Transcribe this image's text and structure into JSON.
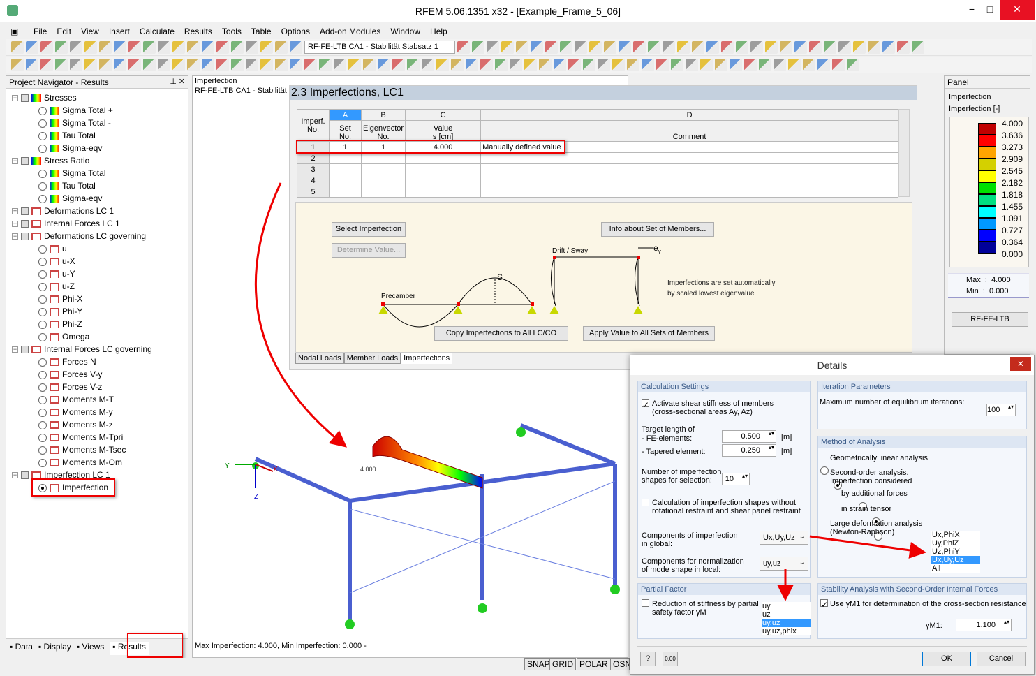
{
  "window": {
    "title": "RFEM 5.06.1351 x32 - [Example_Frame_5_06]",
    "minimize": "−",
    "maximize": "□",
    "close": "✕"
  },
  "menu": [
    "File",
    "Edit",
    "View",
    "Insert",
    "Calculate",
    "Results",
    "Tools",
    "Table",
    "Options",
    "Add-on Modules",
    "Window",
    "Help"
  ],
  "toolbar": {
    "case_combo": "RF-FE-LTB CA1 - Stabilität Stabsatz 1"
  },
  "navigator": {
    "title": "Project Navigator - Results",
    "items": [
      {
        "label": "Stresses",
        "level": 0,
        "kind": "check",
        "icon": "stress-icon",
        "exp": "−"
      },
      {
        "label": "Sigma Total +",
        "level": 1,
        "kind": "radio",
        "icon": "stress-icon"
      },
      {
        "label": "Sigma Total -",
        "level": 1,
        "kind": "radio",
        "icon": "stress-icon"
      },
      {
        "label": "Tau Total",
        "level": 1,
        "kind": "radio",
        "icon": "stress-icon"
      },
      {
        "label": "Sigma-eqv",
        "level": 1,
        "kind": "radio",
        "icon": "stress-icon"
      },
      {
        "label": "Stress Ratio",
        "level": 0,
        "kind": "check",
        "icon": "stress-icon",
        "exp": "−"
      },
      {
        "label": "Sigma Total",
        "level": 1,
        "kind": "radio",
        "icon": "stress-icon"
      },
      {
        "label": "Tau Total",
        "level": 1,
        "kind": "radio",
        "icon": "stress-icon"
      },
      {
        "label": "Sigma-eqv",
        "level": 1,
        "kind": "radio",
        "icon": "stress-icon"
      },
      {
        "label": "Deformations LC 1",
        "level": 0,
        "kind": "check",
        "icon": "frame-icon",
        "exp": "+"
      },
      {
        "label": "Internal Forces LC 1",
        "level": 0,
        "kind": "check",
        "icon": "force-icon",
        "exp": "+"
      },
      {
        "label": "Deformations LC governing",
        "level": 0,
        "kind": "check",
        "icon": "frame-icon",
        "exp": "−"
      },
      {
        "label": "u",
        "level": 1,
        "kind": "radio",
        "icon": "frame-icon"
      },
      {
        "label": "u-X",
        "level": 1,
        "kind": "radio",
        "icon": "frame-icon"
      },
      {
        "label": "u-Y",
        "level": 1,
        "kind": "radio",
        "icon": "frame-icon"
      },
      {
        "label": "u-Z",
        "level": 1,
        "kind": "radio",
        "icon": "frame-icon"
      },
      {
        "label": "Phi-X",
        "level": 1,
        "kind": "radio",
        "icon": "frame-icon"
      },
      {
        "label": "Phi-Y",
        "level": 1,
        "kind": "radio",
        "icon": "frame-icon"
      },
      {
        "label": "Phi-Z",
        "level": 1,
        "kind": "radio",
        "icon": "frame-icon"
      },
      {
        "label": "Omega",
        "level": 1,
        "kind": "radio",
        "icon": "frame-icon"
      },
      {
        "label": "Internal Forces LC governing",
        "level": 0,
        "kind": "check",
        "icon": "force-icon",
        "exp": "−"
      },
      {
        "label": "Forces N",
        "level": 1,
        "kind": "radio",
        "icon": "force-icon"
      },
      {
        "label": "Forces V-y",
        "level": 1,
        "kind": "radio",
        "icon": "force-icon"
      },
      {
        "label": "Forces V-z",
        "level": 1,
        "kind": "radio",
        "icon": "force-icon"
      },
      {
        "label": "Moments M-T",
        "level": 1,
        "kind": "radio",
        "icon": "force-icon"
      },
      {
        "label": "Moments M-y",
        "level": 1,
        "kind": "radio",
        "icon": "force-icon"
      },
      {
        "label": "Moments M-z",
        "level": 1,
        "kind": "radio",
        "icon": "force-icon"
      },
      {
        "label": "Moments M-Tpri",
        "level": 1,
        "kind": "radio",
        "icon": "force-icon"
      },
      {
        "label": "Moments M-Tsec",
        "level": 1,
        "kind": "radio",
        "icon": "force-icon"
      },
      {
        "label": "Moments M-Om",
        "level": 1,
        "kind": "radio",
        "icon": "force-icon"
      },
      {
        "label": "Imperfection LC 1",
        "level": 0,
        "kind": "check",
        "icon": "frame-icon",
        "exp": "−"
      },
      {
        "label": "Imperfection",
        "level": 1,
        "kind": "radio",
        "icon": "frame-icon",
        "selected": true
      }
    ],
    "tabs": [
      "Data",
      "Display",
      "Views",
      "Results"
    ]
  },
  "view": {
    "header1": "Imperfection",
    "header2": "RF-FE-LTB CA1 - Stabilität",
    "footer": "Max Imperfection: 4.000, Min Imperfection: 0.000 -",
    "axis_y": "Y",
    "axis_x": "X",
    "axis_z": "Z",
    "value_label": "4.000"
  },
  "table": {
    "title": "2.3 Imperfections, LC1",
    "col_letters": [
      "A",
      "B",
      "C",
      "D"
    ],
    "headers": [
      "Imperf.\nNo.",
      "Set\nNo.",
      "Eigenvector\nNo.",
      "Value\ns [cm]",
      "Comment"
    ],
    "rows": [
      [
        "1",
        "1",
        "1",
        "4.000",
        "Manually defined value"
      ],
      [
        "2",
        "",
        "",
        "",
        ""
      ],
      [
        "3",
        "",
        "",
        "",
        ""
      ],
      [
        "4",
        "",
        "",
        "",
        ""
      ],
      [
        "5",
        "",
        "",
        "",
        ""
      ]
    ],
    "buttons": {
      "select": "Select Imperfection",
      "determine": "Determine Value...",
      "info": "Info about Set of Members...",
      "copy": "Copy Imperfections to All LC/CO",
      "apply": "Apply Value to All Sets of Members"
    },
    "diagram": {
      "precamber": "Precamber",
      "s": "S",
      "drift": "Drift / Sway",
      "ey": "e",
      "ey_sub": "y"
    },
    "note": "Imperfections are set automatically\nby scaled lowest eigenvalue",
    "tabs": [
      "Nodal Loads",
      "Member Loads",
      "Imperfections"
    ]
  },
  "panel": {
    "title": "Panel",
    "line1": "Imperfection",
    "line2": "Imperfection [-]",
    "legend": [
      {
        "v": "4.000",
        "c": "#c00000"
      },
      {
        "v": "3.636",
        "c": "#ff0000"
      },
      {
        "v": "3.273",
        "c": "#ffa500"
      },
      {
        "v": "2.909",
        "c": "#d4d000"
      },
      {
        "v": "2.545",
        "c": "#ffff00"
      },
      {
        "v": "2.182",
        "c": "#00e000"
      },
      {
        "v": "1.818",
        "c": "#00e080"
      },
      {
        "v": "1.455",
        "c": "#00ffff"
      },
      {
        "v": "1.091",
        "c": "#0099ff"
      },
      {
        "v": "0.727",
        "c": "#0000ff"
      },
      {
        "v": "0.364",
        "c": "#000099"
      },
      {
        "v": "0.000",
        "c": null
      }
    ],
    "max_label": "Max",
    "max": "4.000",
    "min_label": "Min",
    "min": "0.000",
    "button": "RF-FE-LTB"
  },
  "status": [
    "SNAP",
    "GRID",
    "POLAR",
    "OSNAP"
  ],
  "dialog": {
    "title": "Details",
    "calc": {
      "title": "Calculation Settings",
      "shear": "Activate shear stiffness of members\n(cross-sectional areas Ay, Az)",
      "shear_checked": true,
      "target": "Target length of",
      "fe": "- FE-elements:",
      "fe_val": "0.500",
      "tap": "- Tapered element:",
      "tap_val": "0.250",
      "unit": "[m]",
      "nshapes": "Number of imperfection\nshapes for selection:",
      "nshapes_val": "10",
      "without": "Calculation of imperfection shapes without\nrotational restraint and shear panel restraint",
      "without_checked": false,
      "comp_global": "Components of imperfection\nin global:",
      "comp_global_val": "Ux,Uy,Uz",
      "comp_local": "Components for normalization\nof mode shape in local:",
      "comp_local_val": "uy,uz"
    },
    "iter": {
      "title": "Iteration Parameters",
      "max": "Maximum number of equilibrium iterations:",
      "max_val": "100"
    },
    "method": {
      "title": "Method of Analysis",
      "linear": "Geometrically linear analysis",
      "second": "Second-order analysis.\nImperfection considered",
      "by_add": "by additional forces",
      "strain": "in strain tensor",
      "large": "Large deformation analysis\n(Newton-Raphson)"
    },
    "global_options": [
      "Ux,PhiX",
      "Uy,PhiZ",
      "Uz,PhiY",
      "Ux,Uy,Uz",
      "All"
    ],
    "global_selected": 3,
    "local_options": [
      "uy",
      "uz",
      "uy,uz",
      "uy,uz,phix"
    ],
    "local_selected": 2,
    "partial": {
      "title": "Partial Factor",
      "reduction": "Reduction of stiffness by partial\nsafety factor γM",
      "checked": false
    },
    "stability": {
      "title": "Stability Analysis with Second-Order Internal Forces",
      "use": "Use γM1 for determination of the cross-section resistance",
      "checked": true,
      "gamma_label": "γM1:",
      "gamma_val": "1.100"
    },
    "ok": "OK",
    "cancel": "Cancel"
  },
  "colors": {
    "accent_red": "#e00000",
    "selection": "#3399ff",
    "table_header": "#c4d0de",
    "group_header": "#dde6f3"
  }
}
